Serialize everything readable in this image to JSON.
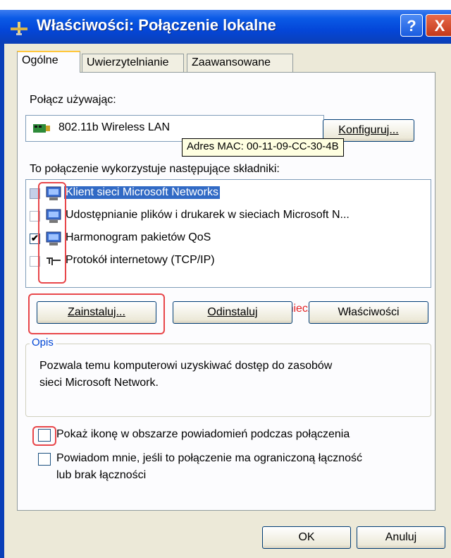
{
  "window": {
    "title": "Właściwości: Połączenie lokalne",
    "help_button": "?",
    "close_button": "X"
  },
  "tabs": [
    {
      "label": "Ogólne",
      "active": true
    },
    {
      "label": "Uwierzytelnianie",
      "active": false
    },
    {
      "label": "Zaawansowane",
      "active": false
    }
  ],
  "connect_using": {
    "label": "Połącz używając:",
    "device": "802.11b Wireless LAN",
    "configure_button": "Konfiguruj...",
    "tooltip": "Adres MAC: 00-11-09-CC-30-4B"
  },
  "components": {
    "label": "To połączenie wykorzystuje następujące składniki:",
    "items": [
      {
        "label": "Klient sieci Microsoft Networks",
        "checked": false,
        "icon": "network-client-icon",
        "selected": true
      },
      {
        "label": "Udostępnianie plików i drukarek w sieciach Microsoft N...",
        "checked": false,
        "icon": "file-printer-sharing-icon",
        "selected": false
      },
      {
        "label": "Harmonogram pakietów QoS",
        "checked": true,
        "icon": "qos-scheduler-icon",
        "selected": false
      },
      {
        "label": "Protokół internetowy (TCP/IP)",
        "checked": false,
        "icon": "protocol-icon",
        "selected": false
      }
    ],
    "annotation": "Koniecznie niezaznaczone!"
  },
  "buttons": {
    "install": "Zainstaluj...",
    "uninstall": "Odinstaluj",
    "properties": "Właściwości",
    "ok": "OK",
    "cancel": "Anuluj"
  },
  "description": {
    "legend": "Opis",
    "text_line1": "Pozwala temu komputerowi uzyskiwać dostęp do zasobów",
    "text_line2": "sieci Microsoft Network."
  },
  "options": {
    "show_icon": "Pokaż ikonę w obszarze powiadomień podczas połączenia",
    "notify_line1": "Powiadom mnie, jeśli to połączenie ma ograniczoną łączność",
    "notify_line2": "lub brak łączności"
  },
  "colors": {
    "titlebar": "#0a5ae6",
    "annotation_red": "#e52326",
    "selection": "#316ac5"
  }
}
